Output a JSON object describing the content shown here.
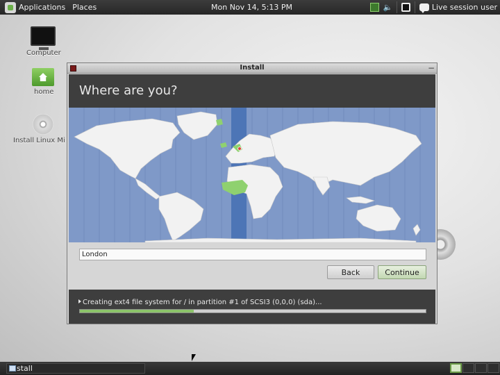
{
  "top_panel": {
    "applications": "Applications",
    "places": "Places",
    "clock": "Mon Nov 14,  5:13 PM",
    "user": "Live session user"
  },
  "desktop": {
    "computer": "Computer",
    "home": "home",
    "install": "Install Linux Mi"
  },
  "window": {
    "title": "Install",
    "heading": "Where are you?",
    "location_value": "London",
    "back_label": "Back",
    "continue_label": "Continue",
    "status": "Creating ext4 file system for / in partition #1 of SCSI3 (0,0,0) (sda)...",
    "progress": 0.33
  },
  "taskbar": {
    "task_label": "stall",
    "workspaces": 4,
    "active_workspace": 1
  },
  "colors": {
    "ocean": "#7f99c8",
    "land": "#f2f2f2",
    "selected_zone": "#4d75b6",
    "highlight_land": "#8fd16f"
  }
}
